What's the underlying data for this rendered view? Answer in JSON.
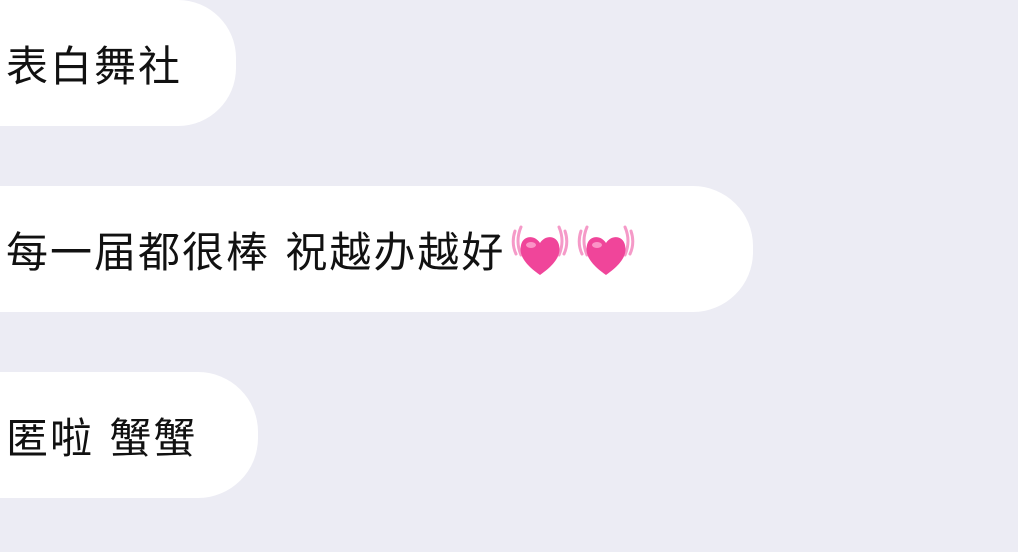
{
  "messages": [
    {
      "text": "表白舞社"
    },
    {
      "text": "每一届都很棒 祝越办越好",
      "emoji": [
        "beating-heart-icon",
        "beating-heart-icon"
      ]
    },
    {
      "text": "匿啦 蟹蟹"
    }
  ],
  "colors": {
    "background": "#ECECF4",
    "bubble": "#FFFFFF",
    "text": "#111111",
    "heart": "#F0459A",
    "heart_lines": "#F59AC8"
  }
}
